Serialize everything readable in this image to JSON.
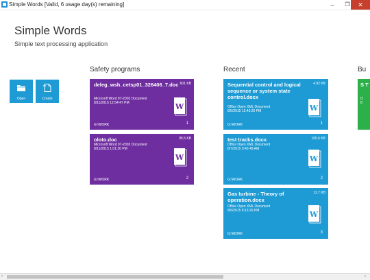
{
  "window": {
    "title": "Simple Words [Valid, 6 usage day(s) remaining]",
    "min_glyph": "–",
    "max_glyph": "❐",
    "close_glyph": "✕"
  },
  "app": {
    "title": "Simple Words",
    "subtitle": "Simple text processing application"
  },
  "actions": {
    "open_label": "Open",
    "create_label": "Create",
    "open_icon": "folder-icon",
    "create_icon": "new-document-icon"
  },
  "sections": {
    "safety_programs": "Safety programs",
    "recent": "Recent",
    "bu": "Bu"
  },
  "safety_cards": [
    {
      "name": "deleg_wsh_cetsp01_326406_7.doc",
      "size": "601 KB",
      "type": "Microsoft Word 97-2003 Document",
      "date": "8/11/2015 12:54:47 PM",
      "path": "G:\\WORK",
      "count": "1"
    },
    {
      "name": "oloto.doc",
      "size": "95.5 KB",
      "type": "Microsoft Word 97-2003 Document",
      "date": "8/11/2015 1:01:20 PM",
      "path": "G:\\WORK",
      "count": "2"
    }
  ],
  "recent_cards": [
    {
      "name": "Sequential control and logical sequence or system state control.docx",
      "size": "4.92 KB",
      "type": "Office Open XML Document",
      "date": "8/5/2015 12:45:26 PM",
      "path": "G:\\WORK",
      "count": "1"
    },
    {
      "name": "test tracks.docx",
      "size": "165.6 KB",
      "type": "Office Open XML Document",
      "date": "8/7/2015 9:43:49 AM",
      "path": "G:\\WORK",
      "count": "2"
    },
    {
      "name": "Gas turbine - Theory of operation.docx",
      "size": "12.7 KB",
      "type": "Office Open XML Document",
      "date": "8/6/2015 8:13:26 PM",
      "path": "G:\\WORK",
      "count": "3"
    }
  ],
  "partial_card": {
    "name": "S T",
    "type": "O",
    "date": "8"
  },
  "scrollbar": {
    "left_arrow": "‹",
    "right_arrow": "›"
  },
  "colors": {
    "purple": "#6f2ea0",
    "blue": "#1e9bd4",
    "green": "#2cb14a",
    "close_red": "#c7402e"
  }
}
